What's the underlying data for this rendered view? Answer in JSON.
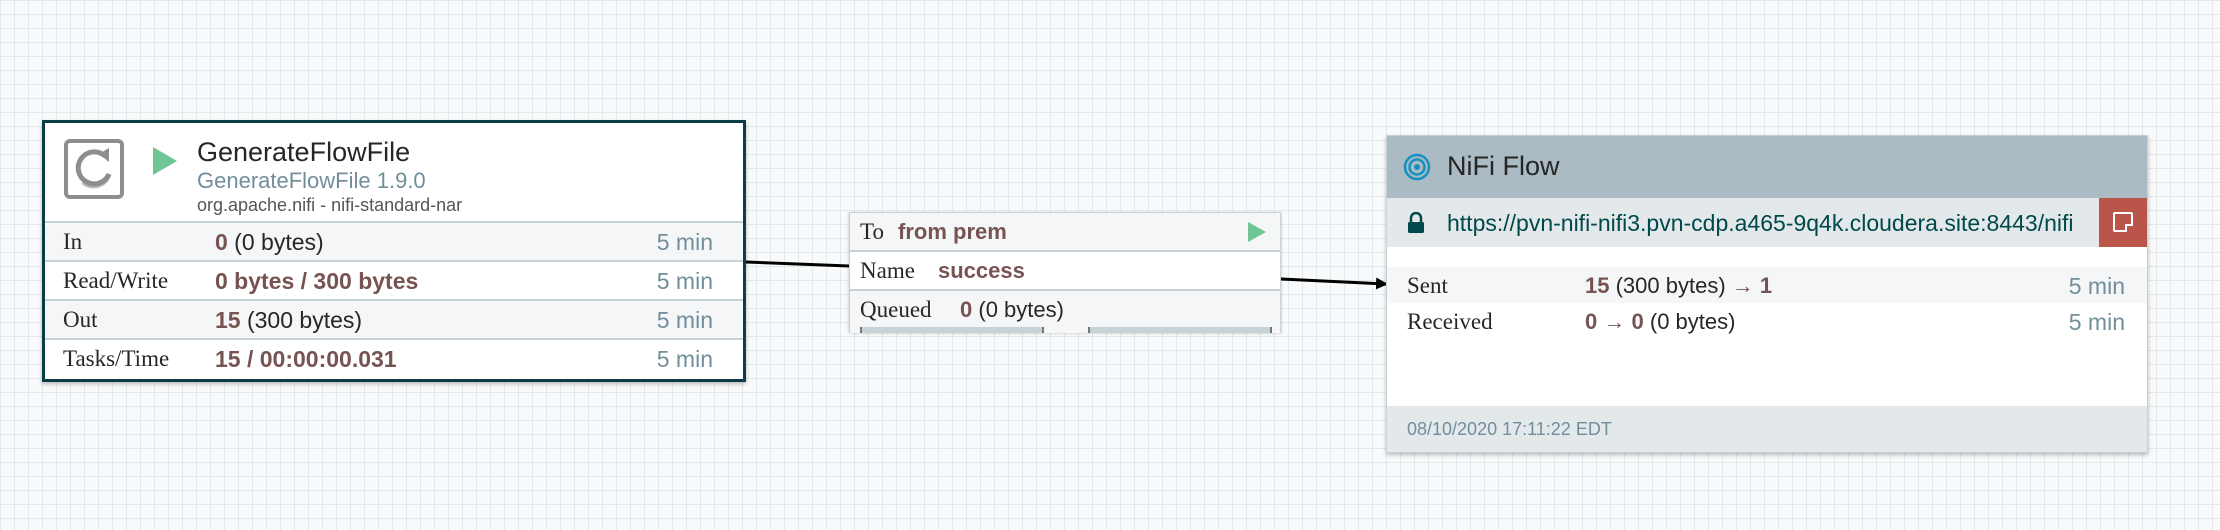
{
  "processor": {
    "name": "GenerateFlowFile",
    "type": "GenerateFlowFile 1.9.0",
    "bundle": "org.apache.nifi - nifi-standard-nar",
    "icon": "processor-icon",
    "state_icon": "run-icon",
    "stats": [
      {
        "label": "In",
        "value": "0",
        "detail": " (0 bytes)",
        "time": "5 min"
      },
      {
        "label": "Read/Write",
        "value": "0 bytes / 300 bytes",
        "detail": "",
        "time": "5 min"
      },
      {
        "label": "Out",
        "value": "15",
        "detail": " (300 bytes)",
        "time": "5 min"
      },
      {
        "label": "Tasks/Time",
        "value": "15 / 00:00:00.031",
        "detail": "",
        "time": "5 min"
      }
    ]
  },
  "connection": {
    "to_label": "To",
    "to_value": "from prem",
    "name_label": "Name",
    "name_value": "success",
    "queued_label": "Queued",
    "queued_value": "0",
    "queued_detail": " (0 bytes)"
  },
  "rpg": {
    "name": "NiFi Flow",
    "url": "https://pvn-nifi-nifi3.pvn-cdp.a465-9q4k.cloudera.site:8443/nifi",
    "sent_label": "Sent",
    "sent_count": "15",
    "sent_detail": " (300 bytes) ",
    "sent_arrow": "→",
    "sent_ports": "1",
    "sent_time": "5 min",
    "received_label": "Received",
    "received_ports": "0",
    "received_arrow": "→",
    "received_count": "0",
    "received_detail": " (0 bytes)",
    "received_time": "5 min",
    "last_refreshed": "08/10/2020 17:11:22 EDT"
  },
  "colors": {
    "accent": "#0b3d47",
    "running": "#6ec697",
    "value": "#775351",
    "muted": "#728e9b",
    "header": "#aabbc3",
    "comment": "#ba554a"
  }
}
